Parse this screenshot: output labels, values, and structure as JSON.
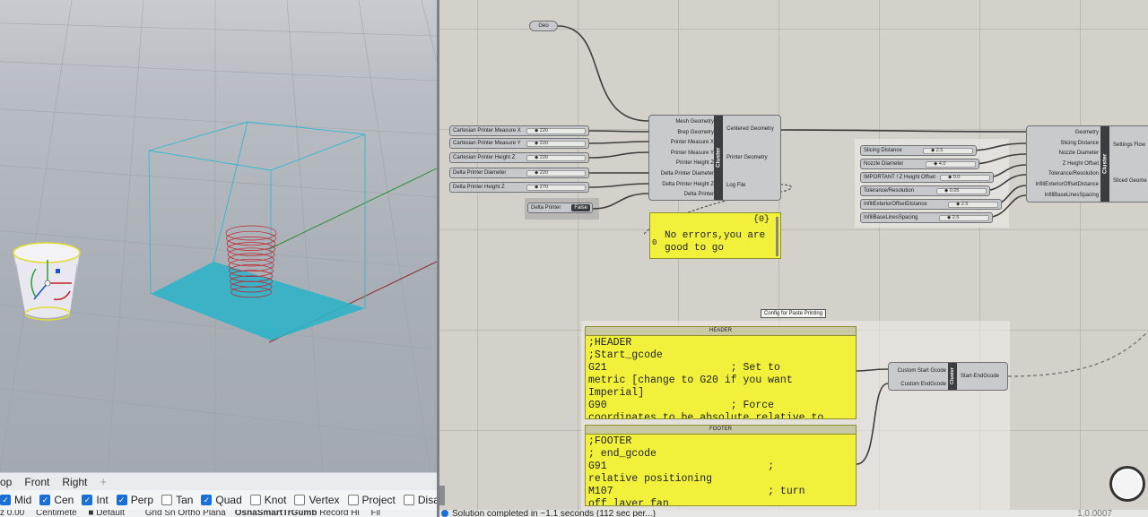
{
  "viewport": {
    "tabs": [
      "op",
      "Front",
      "Right"
    ],
    "add_tab": "+",
    "osnaps": [
      {
        "label": "Mid",
        "checked": true
      },
      {
        "label": "Cen",
        "checked": true
      },
      {
        "label": "Int",
        "checked": true
      },
      {
        "label": "Perp",
        "checked": true
      },
      {
        "label": "Tan",
        "checked": false
      },
      {
        "label": "Quad",
        "checked": true
      },
      {
        "label": "Knot",
        "checked": false
      },
      {
        "label": "Vertex",
        "checked": false
      },
      {
        "label": "Project",
        "checked": false
      },
      {
        "label": "Disable",
        "checked": false
      }
    ],
    "status": {
      "coord": "z 0.00",
      "units": "Centimete",
      "layer": "Default",
      "modes": "Grid Sn Ortho Plana",
      "osnap": "Osna",
      "smarttrack": "SmartTr",
      "gumball": "Gumb",
      "record": "Record Hi",
      "filter": "Fil"
    }
  },
  "grasshopper": {
    "geo_param": "Geo",
    "printer_params": [
      {
        "label": "Cartesian Printer Measure X",
        "value": "220"
      },
      {
        "label": "Cartesian Printer Measure Y",
        "value": "220"
      },
      {
        "label": "Cartesian Printer Height Z",
        "value": "220"
      },
      {
        "label": "Delta Printer Diameter",
        "value": "220"
      },
      {
        "label": "Delta Printer Height Z",
        "value": "270"
      }
    ],
    "toggle": {
      "label": "Delta Printer",
      "value": "False"
    },
    "cluster1": {
      "tag": "Cluster",
      "inputs": [
        "Mesh Geometry",
        "Brep Geometry",
        "Printer Measure X",
        "Printer Measure Y",
        "Printer Height Z",
        "Delta Printer Diameter",
        "Delta Printer Height Z",
        "Delta Printer"
      ],
      "outputs": [
        "Centered Geometry",
        "Printer Geometry",
        "Log File"
      ]
    },
    "log_panel": {
      "index": "{0}",
      "row": "0",
      "text": "No errors,you are good to go"
    },
    "slicing_params": [
      {
        "label": "Slicing Distance",
        "value": "2.5"
      },
      {
        "label": "Nozzle Diameter",
        "value": "4.0"
      },
      {
        "label": "IMPORTANT ! Z Height Offset",
        "value": "0.0"
      },
      {
        "label": "Tolerance/Resolution",
        "value": "0.05"
      },
      {
        "label": "InfillExteriorOffsetDistance",
        "value": "2.5"
      },
      {
        "label": "InfillBaseLinesSpacing",
        "value": "2.5"
      }
    ],
    "cluster2": {
      "tag": "Cluster",
      "inputs": [
        "Geometry",
        "Slicing Distance",
        "Nozzle Diameter",
        "Z Height Offset",
        "Tolerance/Resolution",
        "InfillExteriorOffsetDistance",
        "InfillBaseLinesSpacing"
      ],
      "outputs": [
        "Settings Flow",
        "Sliced Geome"
      ]
    },
    "group_label": "Config for Paste Printing",
    "header_panel": {
      "title": "HEADER",
      "lines": [
        ";HEADER",
        ";Start_gcode",
        "G21                    ; Set to",
        "metric [change to G20 if you want",
        "Imperial]",
        "G90                    ; Force",
        "coordinates to be absolute relative to"
      ]
    },
    "footer_panel": {
      "title": "FOOTER",
      "lines": [
        ";FOOTER",
        "; end_gcode",
        "G91                          ;",
        "relative positioning",
        "M107                         ; turn",
        "off layer fan"
      ]
    },
    "cluster3": {
      "tag": "Cluster",
      "inputs": [
        "Custom Start Gcode",
        "Custom EndGcode"
      ],
      "outputs": [
        "Start-EndGcode"
      ]
    },
    "status_text": "Solution completed in ~1.1 seconds (112 sec per...)",
    "version": "1.0.0007"
  },
  "colors": {
    "panel_yellow": "#f1f03a",
    "selection_cyan": "#2fb3c8",
    "object_red": "#c0202a",
    "osnap_blue": "#1a6fd6"
  }
}
